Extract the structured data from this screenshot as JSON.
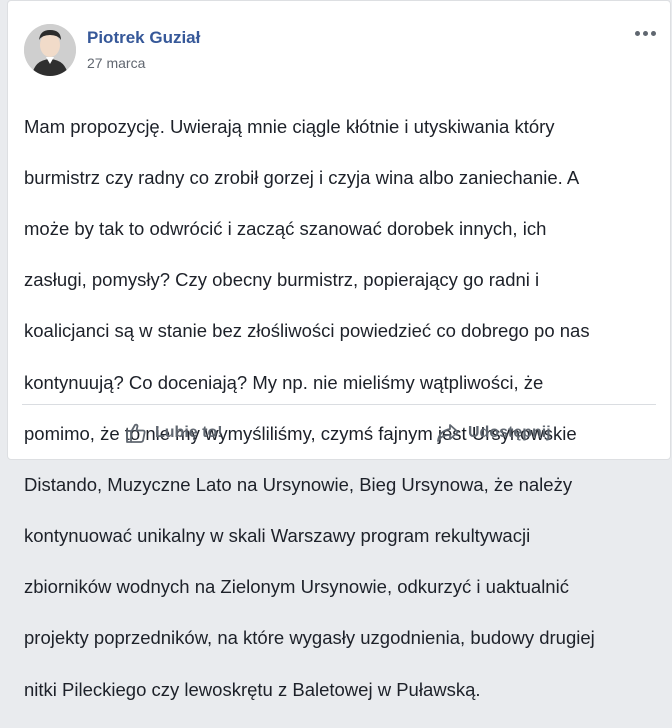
{
  "post": {
    "author_name": "Piotrek Guział",
    "date": "27 marca",
    "more_icon": "more-horizontal-icon",
    "text_lines": [
      "Mam propozycję. Uwierają mnie ciągle kłótnie i utyskiwania który",
      "burmistrz czy radny co zrobił gorzej i czyja wina albo zaniechanie. A",
      "może by tak to odwrócić i zacząć szanować dorobek innych, ich",
      "zasługi, pomysły? Czy obecny burmistrz, popierający go radni i",
      "koalicjanci są w stanie bez złośliwości powiedzieć co dobrego po nas",
      "kontynuują? Co doceniają? My np. nie mieliśmy wątpliwości, że",
      "pomimo, że to nie my wymyśliliśmy, czymś fajnym jest Ursynowskie",
      "Distando, Muzyczne Lato na Ursynowie, Bieg Ursynowa, że należy",
      "kontynuować unikalny w skali Warszawy program rekultywacji",
      "zbiorników wodnych na Zielonym Ursynowie, odkurzyć i uaktualnić",
      "projekty poprzedników, na które wygasły uzgodnienia, budowy drugiej",
      "nitki Pileckiego czy lewoskrętu z Baletowej w Puławską."
    ]
  },
  "actions": {
    "like_label": "Lubię to!",
    "like_icon": "thumbs-up-icon",
    "share_label": "Udostępnij",
    "share_icon": "share-arrow-icon"
  },
  "colors": {
    "author_link": "#365899",
    "text": "#1d2129",
    "muted": "#606770",
    "background": "#e9ebee"
  }
}
